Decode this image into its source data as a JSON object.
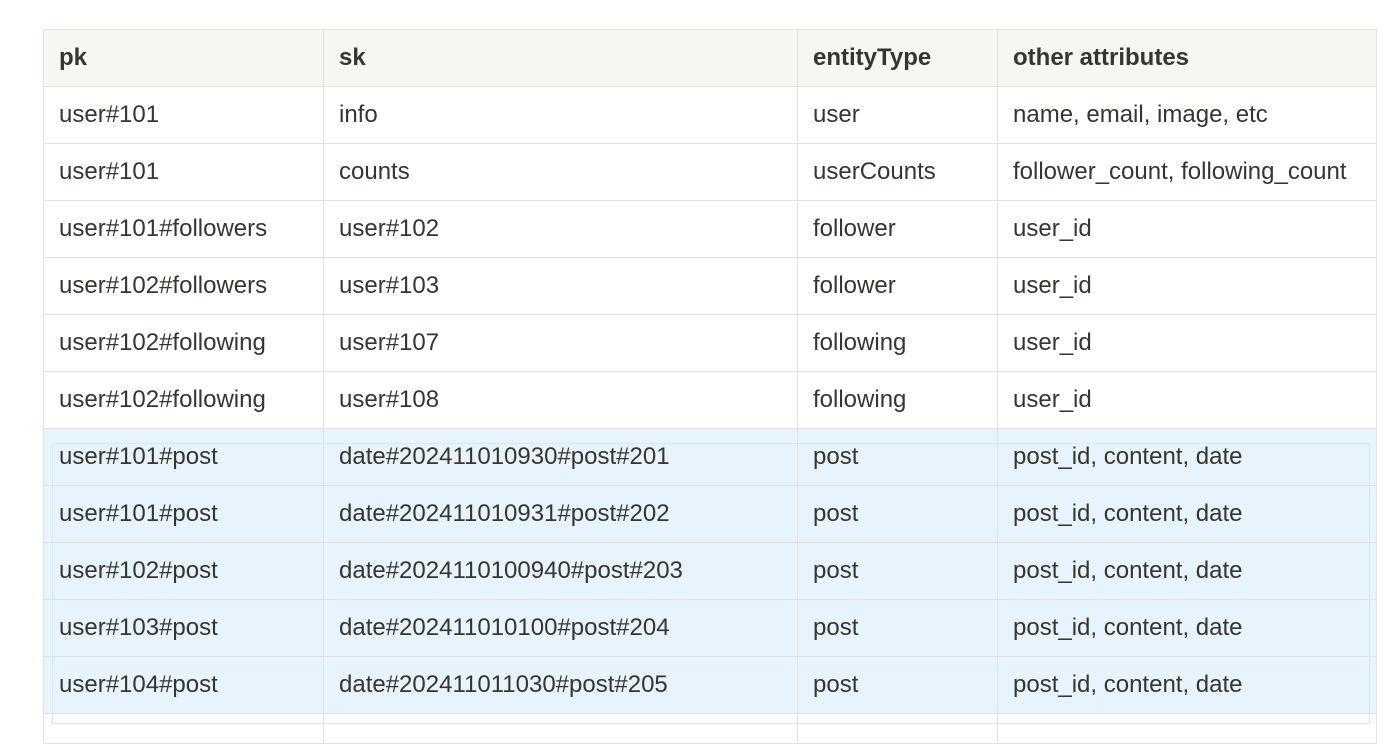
{
  "table": {
    "headers": [
      "pk",
      "sk",
      "entityType",
      "other attributes"
    ],
    "rows": [
      {
        "pk": "user#101",
        "sk": "info",
        "entityType": "user",
        "other": "name, email, image, etc",
        "selected": false
      },
      {
        "pk": "user#101",
        "sk": "counts",
        "entityType": "userCounts",
        "other": "follower_count, following_count",
        "selected": false
      },
      {
        "pk": "user#101#followers",
        "sk": "user#102",
        "entityType": "follower",
        "other": "user_id",
        "selected": false
      },
      {
        "pk": "user#102#followers",
        "sk": "user#103",
        "entityType": "follower",
        "other": "user_id",
        "selected": false
      },
      {
        "pk": "user#102#following",
        "sk": "user#107",
        "entityType": "following",
        "other": "user_id",
        "selected": false
      },
      {
        "pk": "user#102#following",
        "sk": "user#108",
        "entityType": "following",
        "other": "user_id",
        "selected": false
      },
      {
        "pk": "user#101#post",
        "sk": "date#202411010930#post#201",
        "entityType": "post",
        "other": "post_id, content, date",
        "selected": true
      },
      {
        "pk": "user#101#post",
        "sk": "date#202411010931#post#202",
        "entityType": "post",
        "other": "post_id, content, date",
        "selected": true
      },
      {
        "pk": "user#102#post",
        "sk": "date#2024110100940#post#203",
        "entityType": "post",
        "other": "post_id, content, date",
        "selected": true
      },
      {
        "pk": "user#103#post",
        "sk": "date#202411010100#post#204",
        "entityType": "post",
        "other": "post_id, content, date",
        "selected": true
      },
      {
        "pk": "user#104#post",
        "sk": "date#202411011030#post#205",
        "entityType": "post",
        "other": "post_id, content, date",
        "selected": true
      }
    ]
  },
  "colors": {
    "header_bg": "#f7f6f3",
    "border": "#e3e2e0",
    "selected_bg": "#e8f4fd",
    "text": "#37352f"
  }
}
